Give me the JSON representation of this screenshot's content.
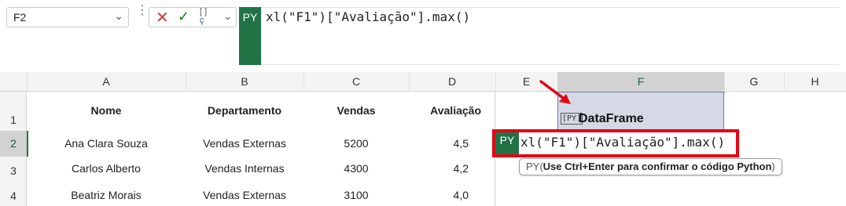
{
  "name_box": {
    "value": "F2"
  },
  "formula_bar": {
    "cancel_icon": "✕",
    "enter_icon": "✓",
    "python_tag": "PY",
    "formula": "xl(\"F1\")[\"Avaliação\"].max()"
  },
  "columns": [
    "A",
    "B",
    "C",
    "D",
    "E",
    "F",
    "G",
    "H"
  ],
  "rows": [
    "1",
    "2",
    "3",
    "4"
  ],
  "table": {
    "headers": [
      "Nome",
      "Departamento",
      "Vendas",
      "Avaliação"
    ],
    "data": [
      [
        "Ana Clara Souza",
        "Vendas Externas",
        "5200",
        "4,5"
      ],
      [
        "Carlos Alberto",
        "Vendas Internas",
        "4300",
        "4,2"
      ],
      [
        "Beatriz Morais",
        "Vendas Externas",
        "3100",
        "4,0"
      ]
    ]
  },
  "f1": {
    "icon": "[PY]",
    "label": "DataFrame"
  },
  "editor": {
    "python_tag": "PY",
    "formula": "xl(\"F1\")[\"Avaliação\"].max()"
  },
  "tooltip": {
    "prefix": "PY(",
    "text": "Use Ctrl+Enter para confirmar o código Python",
    "suffix": ")"
  },
  "colors": {
    "excel_green": "#217346",
    "highlight_red": "#e30613",
    "dataframe_fill": "#d5d9e5"
  }
}
